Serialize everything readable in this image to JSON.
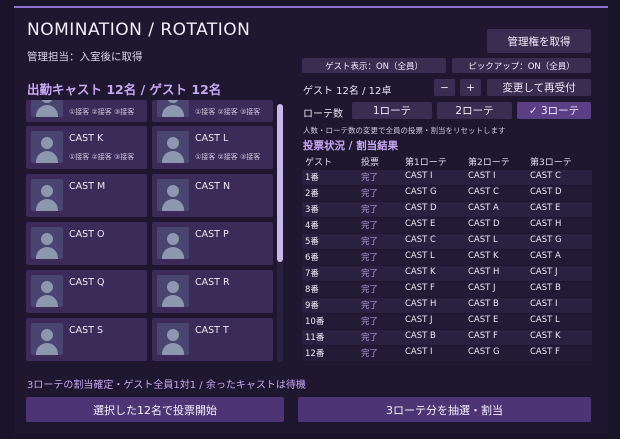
{
  "header": {
    "title": "NOMINATION / ROTATION",
    "subtitle": "管理担当：入室後に取得",
    "take_admin_label": "管理権を取得"
  },
  "cast_section": {
    "title": "出勤キャスト 12名 / ゲスト 12名",
    "tag_text": "①接客 ②接客 ③接客",
    "cards": [
      {
        "name": ""
      },
      {
        "name": ""
      },
      {
        "name": "CAST K"
      },
      {
        "name": "CAST L"
      },
      {
        "name": "CAST M"
      },
      {
        "name": "CAST N"
      },
      {
        "name": "CAST O"
      },
      {
        "name": "CAST P"
      },
      {
        "name": "CAST Q"
      },
      {
        "name": "CAST R"
      },
      {
        "name": "CAST S"
      },
      {
        "name": "CAST T"
      }
    ]
  },
  "controls": {
    "guest_display": "ゲスト表示：ON（全員）",
    "pickup": "ピックアップ：ON（全員）",
    "guest_table_label": "ゲスト 12名 / 12卓",
    "minus": "−",
    "plus": "+",
    "reaccept": "変更して再受付",
    "rotation_label": "ローテ数",
    "rot1": "1ローテ",
    "rot2": "2ローテ",
    "rot3": "✓ 3ローテ",
    "reset_note": "人数・ローテ数の変更で全員の投票・割当をリセットします"
  },
  "vote": {
    "title": "投票状況 / 割当結果",
    "headers": [
      "ゲスト",
      "投票",
      "第1ローテ",
      "第2ローテ",
      "第3ローテ"
    ],
    "rows": [
      [
        "1番",
        "完了",
        "CAST I",
        "CAST I",
        "CAST C"
      ],
      [
        "2番",
        "完了",
        "CAST G",
        "CAST C",
        "CAST D"
      ],
      [
        "3番",
        "完了",
        "CAST D",
        "CAST A",
        "CAST E"
      ],
      [
        "4番",
        "完了",
        "CAST E",
        "CAST D",
        "CAST H"
      ],
      [
        "5番",
        "完了",
        "CAST C",
        "CAST L",
        "CAST G"
      ],
      [
        "6番",
        "完了",
        "CAST L",
        "CAST K",
        "CAST A"
      ],
      [
        "7番",
        "完了",
        "CAST K",
        "CAST H",
        "CAST J"
      ],
      [
        "8番",
        "完了",
        "CAST F",
        "CAST J",
        "CAST B"
      ],
      [
        "9番",
        "完了",
        "CAST H",
        "CAST B",
        "CAST I"
      ],
      [
        "10番",
        "完了",
        "CAST J",
        "CAST E",
        "CAST L"
      ],
      [
        "11番",
        "完了",
        "CAST B",
        "CAST F",
        "CAST K"
      ],
      [
        "12番",
        "完了",
        "CAST I",
        "CAST G",
        "CAST F"
      ]
    ]
  },
  "footer": {
    "note": "3ローテの割当確定・ゲスト全員1対1 / 余ったキャストは待機",
    "start_vote": "選択した12名で投票開始",
    "draw_assign": "3ローテ分を抽選・割当"
  }
}
